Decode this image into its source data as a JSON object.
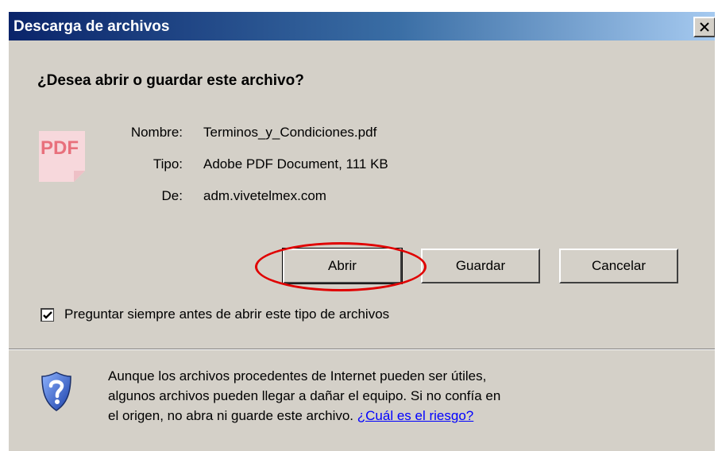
{
  "window": {
    "title": "Descarga de archivos",
    "close_glyph": "×"
  },
  "prompt": {
    "question": "¿Desea abrir o guardar este archivo?"
  },
  "file": {
    "icon": "pdf-icon",
    "icon_text": "PDF",
    "name_label": "Nombre:",
    "name_value": "Terminos_y_Condiciones.pdf",
    "type_label": "Tipo:",
    "type_value": "Adobe PDF Document, 111 KB",
    "from_label": "De:",
    "from_value": "adm.vivetelmex.com"
  },
  "buttons": {
    "open": "Abrir",
    "save": "Guardar",
    "cancel": "Cancelar"
  },
  "checkbox": {
    "checked": true,
    "label": "Preguntar siempre antes de abrir este tipo de archivos"
  },
  "warning": {
    "icon": "shield-question-icon",
    "line1": "Aunque los archivos procedentes de Internet pueden ser útiles,",
    "line2": "algunos archivos pueden llegar a dañar el equipo. Si no confía en",
    "line3": "el origen, no abra ni guarde este archivo.",
    "link": "¿Cuál es el riesgo?"
  },
  "colors": {
    "dialog_bg": "#d4d0c8",
    "titlebar_start": "#0a246a",
    "titlebar_end": "#a6caf0",
    "highlight": "#e00000",
    "link": "#0000ff"
  }
}
